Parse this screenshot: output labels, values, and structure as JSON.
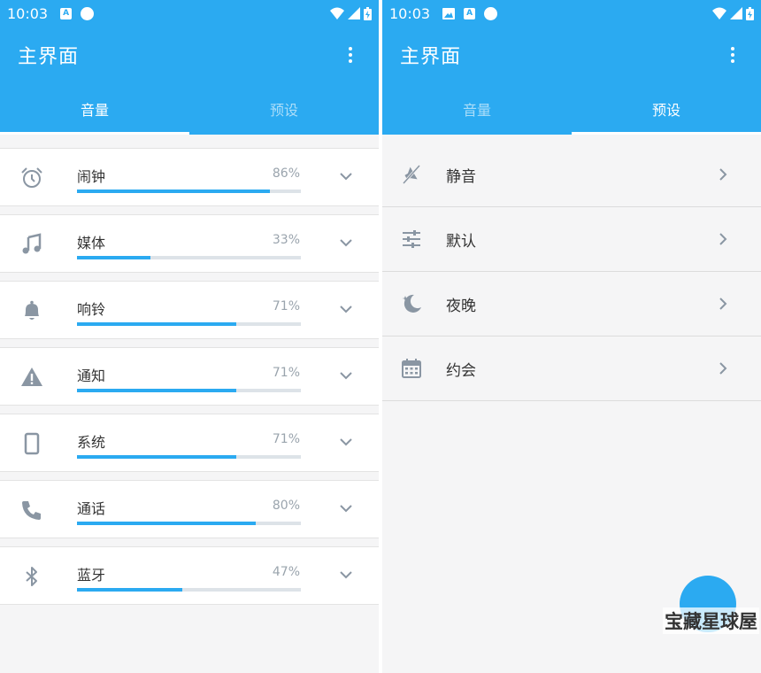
{
  "status": {
    "time": "10:03",
    "left_badge": "A",
    "right_badge": "A"
  },
  "app": {
    "title": "主界面"
  },
  "tabs": [
    {
      "label": "音量"
    },
    {
      "label": "预设"
    }
  ],
  "volumes": [
    {
      "label": "闹钟",
      "percent_text": "86%",
      "level": 0.86,
      "icon": "alarm-icon"
    },
    {
      "label": "媒体",
      "percent_text": "33%",
      "level": 0.33,
      "icon": "music-icon"
    },
    {
      "label": "响铃",
      "percent_text": "71%",
      "level": 0.71,
      "icon": "bell-icon"
    },
    {
      "label": "通知",
      "percent_text": "71%",
      "level": 0.71,
      "icon": "warning-icon"
    },
    {
      "label": "系统",
      "percent_text": "71%",
      "level": 0.71,
      "icon": "phone-device-icon"
    },
    {
      "label": "通话",
      "percent_text": "80%",
      "level": 0.8,
      "icon": "call-icon"
    },
    {
      "label": "蓝牙",
      "percent_text": "47%",
      "level": 0.47,
      "icon": "bluetooth-icon"
    }
  ],
  "presets": [
    {
      "label": "静音",
      "icon": "mute-icon"
    },
    {
      "label": "默认",
      "icon": "sliders-icon"
    },
    {
      "label": "夜晚",
      "icon": "moon-icon"
    },
    {
      "label": "约会",
      "icon": "calendar-icon"
    }
  ],
  "watermark": {
    "text": "宝藏星球屋"
  },
  "colors": {
    "accent": "#2baaf1",
    "track": "#dde3e8",
    "icon": "#8a96a3"
  }
}
